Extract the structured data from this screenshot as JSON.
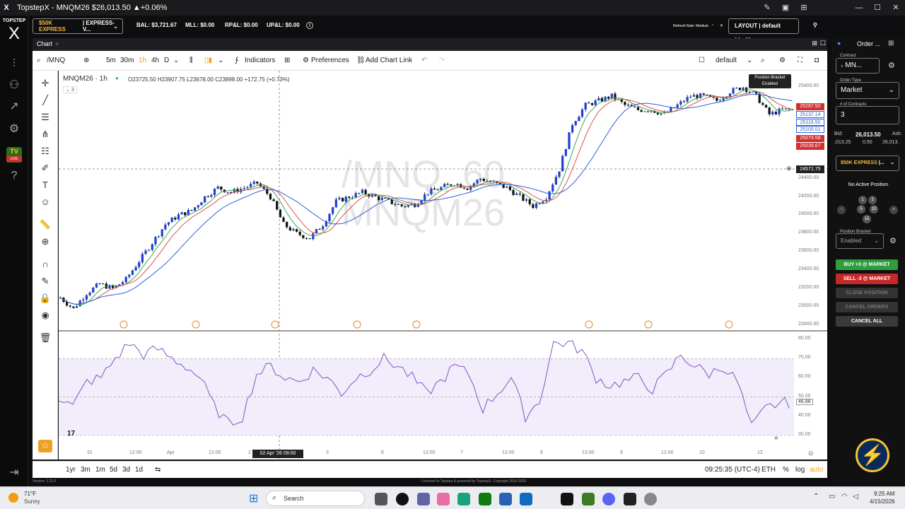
{
  "window": {
    "title": "TopstepX - MNQM26 $26,013.50 ▲+0.06%",
    "logo": "X"
  },
  "account_bar": {
    "account": "$50K EXPRESS",
    "account_suffix": "| EXPRESS-V...",
    "bal": "BAL: $3,721.67",
    "mll": "MLL: $0.00",
    "rpl": "RP&L: $0.00",
    "upl": "UP&L: $0.00",
    "refresh": "Refresh Rate: Medium",
    "layout": "LAYOUT | default (draft)"
  },
  "rail": {
    "brand_top": "TOPSTEP",
    "brand_x": "X",
    "tv": "TV",
    "live": "LIVE"
  },
  "chart_tab": {
    "label": "Chart",
    "close": "×"
  },
  "toolbar": {
    "symbol": "/MNQ",
    "intervals": [
      "5m",
      "30m",
      "1h",
      "4h",
      "D"
    ],
    "indicators": "Indicators",
    "preferences": "Preferences",
    "add_chart_link": "Add Chart Link",
    "layout_name": "default"
  },
  "chart": {
    "symbol_label": "MNQM26 · 1h",
    "ohlc": "O23725.50 H23907.75 L23678.00 C23898.00 +172.75 (+0.73%)",
    "indicator_count": "3",
    "watermark_1": "/MNQ, 60",
    "watermark_2": "MNQM26",
    "crosshair_price": "24571.75",
    "crosshair_time": "02 Apr '26   09:00",
    "position_bracket_tip": "Position Bracket",
    "position_bracket_state": "Enabled",
    "price_tags": [
      {
        "value": "25287.50",
        "color": "#d32f2f"
      },
      {
        "value": "25137.14",
        "color": "#2e5fd8"
      },
      {
        "value": "25116.50",
        "color": "#2e5fd8"
      },
      {
        "value": "25105.01",
        "color": "#2e5fd8"
      },
      {
        "value": "25079.58",
        "color": "#d32f2f"
      },
      {
        "value": "25039.67",
        "color": "#d32f2f"
      }
    ],
    "y_ticks": [
      "25400.00",
      "24400.00",
      "24200.00",
      "24000.00",
      "23800.00",
      "23600.00",
      "23400.00",
      "23200.00",
      "23000.00",
      "22800.00"
    ],
    "rsi_ticks": [
      "80.00",
      "70.00",
      "60.00",
      "50.00",
      "40.00",
      "30.00"
    ],
    "rsi_value": "46.88",
    "x_ticks": [
      "31",
      "12:00",
      "Apr",
      "12:00",
      "2",
      "3",
      "6",
      "12:00",
      "7",
      "12:00",
      "8",
      "12:00",
      "9",
      "12:00",
      "10",
      "12"
    ],
    "tv_mark": "17"
  },
  "chart_data": {
    "type": "candlestick",
    "symbol": "MNQM26",
    "interval": "1h",
    "ylim": [
      22800,
      25500
    ],
    "close_path": [
      23100,
      22980,
      23150,
      23250,
      23200,
      23300,
      23500,
      23700,
      23900,
      24000,
      24050,
      24200,
      24300,
      24250,
      24300,
      24350,
      24200,
      23900,
      23800,
      23750,
      23900,
      24150,
      24200,
      24250,
      24200,
      24150,
      24100,
      24120,
      24250,
      24300,
      24350,
      24300,
      24400,
      24350,
      24300,
      24200,
      24100,
      24200,
      24500,
      25000,
      25200,
      25250,
      25300,
      25200,
      25150,
      25150,
      25100,
      25200,
      25300,
      25300,
      25250,
      25350,
      25400,
      25300,
      25100,
      25150
    ],
    "rsi_ylim": [
      30,
      80
    ],
    "rsi_path": [
      50,
      45,
      58,
      60,
      70,
      78,
      72,
      75,
      70,
      66,
      60,
      45,
      36,
      40,
      62,
      66,
      60,
      58,
      64,
      60,
      52,
      60,
      64,
      70,
      66,
      60,
      52,
      58,
      66,
      62,
      44,
      52,
      60,
      40,
      48,
      78,
      78,
      74,
      60,
      56,
      58,
      60,
      54,
      62,
      72,
      66,
      62,
      66,
      58,
      34,
      44,
      47
    ]
  },
  "bottom_bar": {
    "ranges": [
      "1yr",
      "3m",
      "1m",
      "5d",
      "3d",
      "1d"
    ],
    "time": "09:25:35 (UTC-4)",
    "session": "ETH",
    "pct": "%",
    "log": "log",
    "auto": "auto"
  },
  "order_panel": {
    "title": "Order ...",
    "contract_label": "Contract",
    "contract": "MN...",
    "order_type_label": "Order Type",
    "order_type": "Market",
    "contracts_label": "# of Contracts",
    "contracts": "3",
    "bid_label": "Bid:",
    "bid": ",013.25",
    "last": "26,013.50",
    "spread": "0.50",
    "ask_label": "Ask:",
    "ask": "26,013.",
    "account": "$50K EXPRESS",
    "account_suffix": "|...",
    "position": "No Active Position",
    "qty_buttons": [
      "1",
      "3",
      "5",
      "10",
      "15"
    ],
    "bracket_label": "Position Bracket",
    "bracket": "Enabled",
    "buy": "BUY +3 @ MARKET",
    "sell": "SELL -3 @ MARKET",
    "close": "CLOSE POSITION",
    "cancel_orders": "CANCEL ORDERS",
    "cancel_all": "CANCEL ALL"
  },
  "footer": {
    "version": "Version: 1.23.5",
    "license": "Licensed to Topstep & powered by TopstepX. Copyright 2024-2026"
  },
  "taskbar": {
    "weather_temp": "71°F",
    "weather_cond": "Sunny",
    "search": "Search",
    "time": "9:25 AM",
    "date": "4/15/2026"
  }
}
